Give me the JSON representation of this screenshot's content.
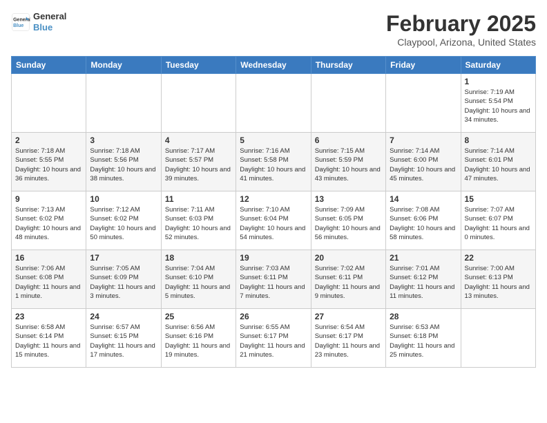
{
  "header": {
    "logo_general": "General",
    "logo_blue": "Blue",
    "month_title": "February 2025",
    "location": "Claypool, Arizona, United States"
  },
  "weekdays": [
    "Sunday",
    "Monday",
    "Tuesday",
    "Wednesday",
    "Thursday",
    "Friday",
    "Saturday"
  ],
  "weeks": [
    [
      {
        "day": "",
        "info": ""
      },
      {
        "day": "",
        "info": ""
      },
      {
        "day": "",
        "info": ""
      },
      {
        "day": "",
        "info": ""
      },
      {
        "day": "",
        "info": ""
      },
      {
        "day": "",
        "info": ""
      },
      {
        "day": "1",
        "info": "Sunrise: 7:19 AM\nSunset: 5:54 PM\nDaylight: 10 hours and 34 minutes."
      }
    ],
    [
      {
        "day": "2",
        "info": "Sunrise: 7:18 AM\nSunset: 5:55 PM\nDaylight: 10 hours and 36 minutes."
      },
      {
        "day": "3",
        "info": "Sunrise: 7:18 AM\nSunset: 5:56 PM\nDaylight: 10 hours and 38 minutes."
      },
      {
        "day": "4",
        "info": "Sunrise: 7:17 AM\nSunset: 5:57 PM\nDaylight: 10 hours and 39 minutes."
      },
      {
        "day": "5",
        "info": "Sunrise: 7:16 AM\nSunset: 5:58 PM\nDaylight: 10 hours and 41 minutes."
      },
      {
        "day": "6",
        "info": "Sunrise: 7:15 AM\nSunset: 5:59 PM\nDaylight: 10 hours and 43 minutes."
      },
      {
        "day": "7",
        "info": "Sunrise: 7:14 AM\nSunset: 6:00 PM\nDaylight: 10 hours and 45 minutes."
      },
      {
        "day": "8",
        "info": "Sunrise: 7:14 AM\nSunset: 6:01 PM\nDaylight: 10 hours and 47 minutes."
      }
    ],
    [
      {
        "day": "9",
        "info": "Sunrise: 7:13 AM\nSunset: 6:02 PM\nDaylight: 10 hours and 48 minutes."
      },
      {
        "day": "10",
        "info": "Sunrise: 7:12 AM\nSunset: 6:02 PM\nDaylight: 10 hours and 50 minutes."
      },
      {
        "day": "11",
        "info": "Sunrise: 7:11 AM\nSunset: 6:03 PM\nDaylight: 10 hours and 52 minutes."
      },
      {
        "day": "12",
        "info": "Sunrise: 7:10 AM\nSunset: 6:04 PM\nDaylight: 10 hours and 54 minutes."
      },
      {
        "day": "13",
        "info": "Sunrise: 7:09 AM\nSunset: 6:05 PM\nDaylight: 10 hours and 56 minutes."
      },
      {
        "day": "14",
        "info": "Sunrise: 7:08 AM\nSunset: 6:06 PM\nDaylight: 10 hours and 58 minutes."
      },
      {
        "day": "15",
        "info": "Sunrise: 7:07 AM\nSunset: 6:07 PM\nDaylight: 11 hours and 0 minutes."
      }
    ],
    [
      {
        "day": "16",
        "info": "Sunrise: 7:06 AM\nSunset: 6:08 PM\nDaylight: 11 hours and 1 minute."
      },
      {
        "day": "17",
        "info": "Sunrise: 7:05 AM\nSunset: 6:09 PM\nDaylight: 11 hours and 3 minutes."
      },
      {
        "day": "18",
        "info": "Sunrise: 7:04 AM\nSunset: 6:10 PM\nDaylight: 11 hours and 5 minutes."
      },
      {
        "day": "19",
        "info": "Sunrise: 7:03 AM\nSunset: 6:11 PM\nDaylight: 11 hours and 7 minutes."
      },
      {
        "day": "20",
        "info": "Sunrise: 7:02 AM\nSunset: 6:11 PM\nDaylight: 11 hours and 9 minutes."
      },
      {
        "day": "21",
        "info": "Sunrise: 7:01 AM\nSunset: 6:12 PM\nDaylight: 11 hours and 11 minutes."
      },
      {
        "day": "22",
        "info": "Sunrise: 7:00 AM\nSunset: 6:13 PM\nDaylight: 11 hours and 13 minutes."
      }
    ],
    [
      {
        "day": "23",
        "info": "Sunrise: 6:58 AM\nSunset: 6:14 PM\nDaylight: 11 hours and 15 minutes."
      },
      {
        "day": "24",
        "info": "Sunrise: 6:57 AM\nSunset: 6:15 PM\nDaylight: 11 hours and 17 minutes."
      },
      {
        "day": "25",
        "info": "Sunrise: 6:56 AM\nSunset: 6:16 PM\nDaylight: 11 hours and 19 minutes."
      },
      {
        "day": "26",
        "info": "Sunrise: 6:55 AM\nSunset: 6:17 PM\nDaylight: 11 hours and 21 minutes."
      },
      {
        "day": "27",
        "info": "Sunrise: 6:54 AM\nSunset: 6:17 PM\nDaylight: 11 hours and 23 minutes."
      },
      {
        "day": "28",
        "info": "Sunrise: 6:53 AM\nSunset: 6:18 PM\nDaylight: 11 hours and 25 minutes."
      },
      {
        "day": "",
        "info": ""
      }
    ]
  ]
}
